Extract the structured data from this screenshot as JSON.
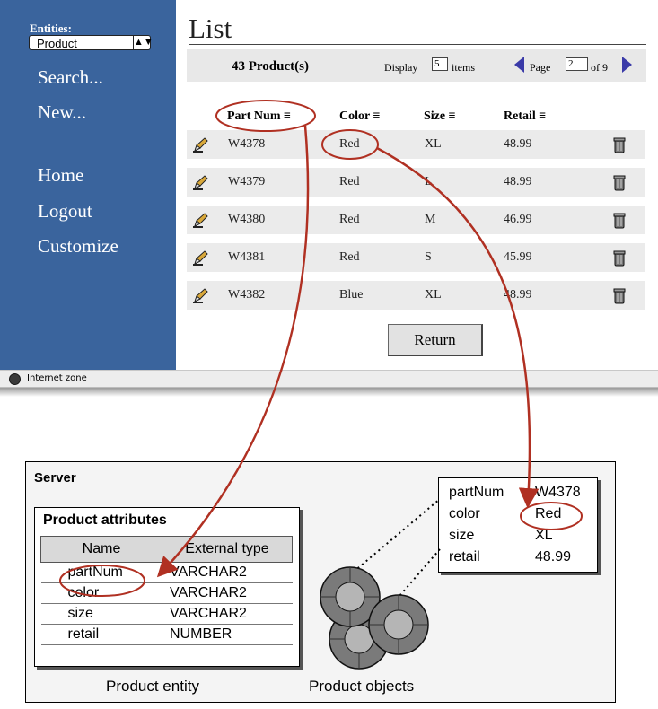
{
  "browser": {
    "sidebar": {
      "entities_label": "Entities:",
      "entity_select_value": "Product",
      "links": [
        "Search...",
        "New...",
        "Home",
        "Logout",
        "Customize"
      ]
    },
    "page_title": "List",
    "info_bar": {
      "count": "43 Product(s)",
      "display_label": "Display",
      "display_value": "5",
      "items_label": "items",
      "page_label": "Page",
      "page_value": "2",
      "of_label": "of 9"
    },
    "table": {
      "columns": [
        "Part Num",
        "Color",
        "Size",
        "Retail"
      ],
      "rows": [
        [
          "W4378",
          "Red",
          "XL",
          "48.99"
        ],
        [
          "W4379",
          "Red",
          "L",
          "48.99"
        ],
        [
          "W4380",
          "Red",
          "M",
          "46.99"
        ],
        [
          "W4381",
          "Red",
          "S",
          "45.99"
        ],
        [
          "W4382",
          "Blue",
          "XL",
          "48.99"
        ]
      ]
    },
    "return_button": "Return",
    "status": "Internet zone"
  },
  "server": {
    "label": "Server",
    "attributes": {
      "title": "Product attributes",
      "headers": [
        "Name",
        "External type"
      ],
      "rows": [
        [
          "partNum",
          "VARCHAR2"
        ],
        [
          "color",
          "VARCHAR2"
        ],
        [
          "size",
          "VARCHAR2"
        ],
        [
          "retail",
          "NUMBER"
        ]
      ],
      "caption": "Product entity"
    },
    "object": {
      "fields": [
        [
          "partNum",
          "W4378"
        ],
        [
          "color",
          "Red"
        ],
        [
          "size",
          "XL"
        ],
        [
          "retail",
          "48.99"
        ]
      ],
      "caption": "Product objects"
    }
  },
  "colors": {
    "sidebar_bg": "#3a649d",
    "annotation_red": "#b03022",
    "row_bg": "#ebebeb",
    "nav_arrow": "#3a3aa8"
  }
}
